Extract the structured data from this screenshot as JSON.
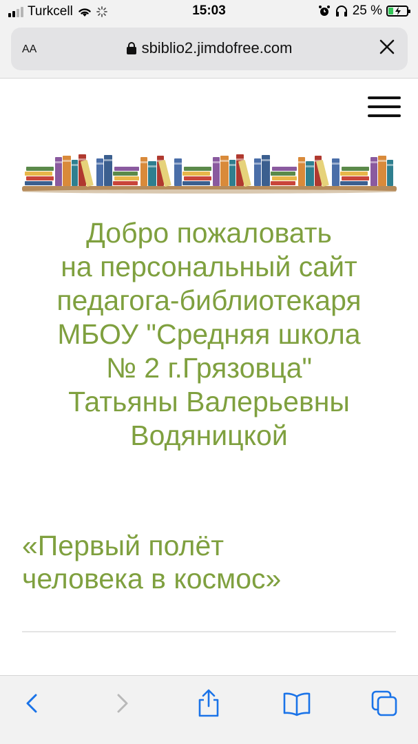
{
  "status_bar": {
    "carrier": "Turkcell",
    "time": "15:03",
    "battery_percent": "25 %",
    "battery_level": 0.25,
    "colors": {
      "battery_fill": "#34c759"
    }
  },
  "browser": {
    "text_size_label": "AA",
    "url": "sbiblio2.jimdofree.com",
    "icons": [
      "lock-icon",
      "close-icon",
      "back-icon",
      "forward-icon",
      "share-icon",
      "bookmarks-icon",
      "tabs-icon"
    ]
  },
  "page": {
    "welcome_lines": [
      "Добро пожаловать",
      "на персональный сайт",
      "педагога-библиотекаря",
      "МБОУ \"Средняя школа",
      "№ 2 г.Грязовца\"",
      "Татьяны Валерьевны",
      "Водяницкой"
    ],
    "subtitle_lines": [
      "«Первый полёт",
      "человека в космос»"
    ],
    "colors": {
      "heading": "#7fa03f",
      "accent_link": "#1a73e8"
    }
  }
}
